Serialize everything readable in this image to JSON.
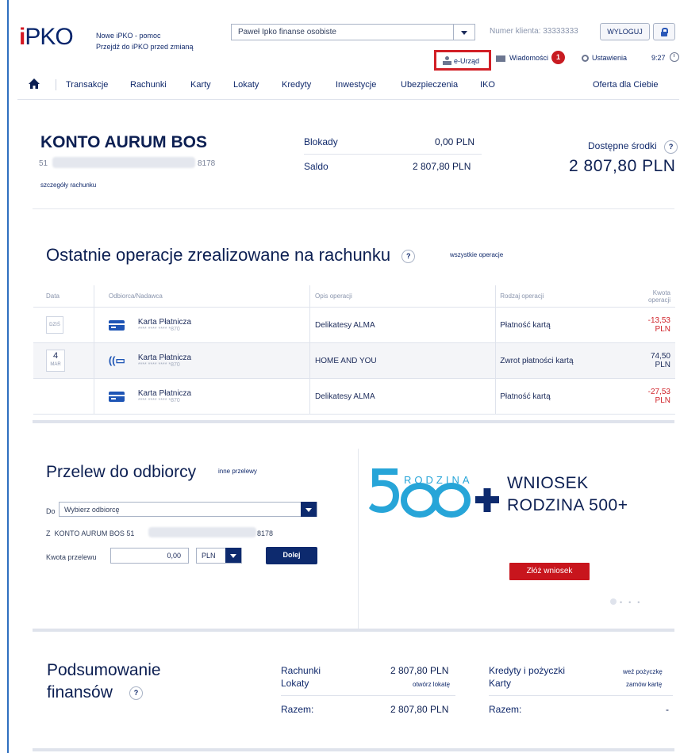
{
  "header": {
    "logo_i": "i",
    "logo_text": "PKO",
    "help_link": "Nowe iPKO - pomoc",
    "switch_link": "Przejdź do iPKO przed zmianą",
    "profile_select": "Paweł Ipko finanse osobiste",
    "client_number": "Numer klienta: 33333333",
    "logout": "WYLOGUJ",
    "eurzad": "e-Urząd",
    "messages": "Wiadomości",
    "messages_count": "1",
    "settings": "Ustawienia",
    "time": "9:27"
  },
  "nav": {
    "items": [
      "Transakcje",
      "Rachunki",
      "Karty",
      "Lokaty",
      "Kredyty",
      "Inwestycje",
      "Ubezpieczenia",
      "IKO"
    ],
    "offer": "Oferta dla Ciebie"
  },
  "account": {
    "name": "KONTO AURUM BOS",
    "number_prefix": "51",
    "number_suffix": "8178",
    "details_link": "szczegóły rachunku",
    "blokady_label": "Blokady",
    "blokady_value": "0,00 PLN",
    "saldo_label": "Saldo",
    "saldo_value": "2 807,80 PLN",
    "available_label": "Dostępne środki",
    "available_value": "2 807,80 PLN",
    "help": "?"
  },
  "operations": {
    "title": "Ostatnie operacje zrealizowane na rachunku",
    "all_link": "wszystkie operacje",
    "columns": [
      "Data",
      "Odbiorca/Nadawca",
      "Opis operacji",
      "Rodzaj operacji",
      "Kwota operacji"
    ],
    "rows": [
      {
        "date": "DZIŚ",
        "day": "",
        "month": "",
        "payer": "Karta Płatnicza",
        "mask": "**** **** **** *870",
        "desc": "Delikatesy ALMA",
        "type": "Płatność kartą",
        "amount": "-13,53 PLN",
        "icon": "card-icon"
      },
      {
        "date": "",
        "day": "4",
        "month": "MAR",
        "payer": "Karta Płatnicza",
        "mask": "**** **** **** *870",
        "desc": "HOME AND YOU",
        "type": "Zwrot płatności kartą",
        "amount": "74,50 PLN",
        "icon": "contactless-card-icon"
      },
      {
        "date": "",
        "day": "",
        "month": "",
        "payer": "Karta Płatnicza",
        "mask": "**** **** **** *870",
        "desc": "Delikatesy ALMA",
        "type": "Płatność kartą",
        "amount": "-27,53 PLN",
        "icon": "card-icon"
      }
    ]
  },
  "transfer": {
    "title": "Przelew do odbiorcy",
    "other_link": "inne przelewy",
    "to_label": "Do",
    "to_placeholder": "Wybierz odbiorcę",
    "from_label": "Z",
    "from_account": "KONTO AURUM BOS 51",
    "from_suffix": "8178",
    "amount_label": "Kwota przelewu",
    "amount_value": "0,00",
    "currency": "PLN",
    "submit": "Dolej"
  },
  "banner": {
    "logo_number": "500+",
    "logo_word": "RODZINA",
    "line1": "WNIOSEK",
    "line2": "RODZINA 500+",
    "button": "Złóż wniosek"
  },
  "summary": {
    "title1": "Podsumowanie",
    "title2": "finansów",
    "rachunki_label": "Rachunki",
    "rachunki_value": "2 807,80 PLN",
    "lokaty_label": "Lokaty",
    "lokaty_link": "otwórz lokatę",
    "razem_label": "Razem:",
    "razem_value": "2 807,80 PLN",
    "kredyty_label": "Kredyty i pożyczki",
    "kredyty_link": "weź pożyczkę",
    "karty_label": "Karty",
    "karty_link": "zamów kartę",
    "razem2_label": "Razem:",
    "razem2_value": "-"
  },
  "colors": {
    "brand": "#06246b",
    "accent_red": "#d0232a",
    "navy": "#0d2a6e",
    "banner_blue": "#27a5d8"
  }
}
